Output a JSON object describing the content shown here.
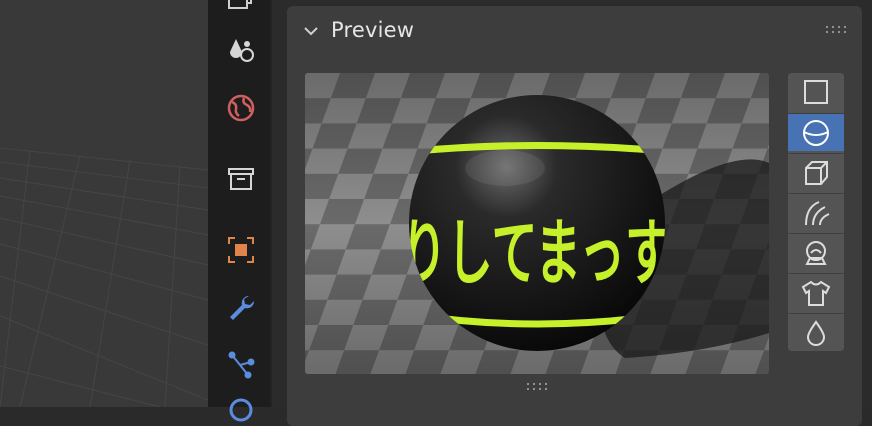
{
  "panel": {
    "title": "Preview"
  },
  "preview": {
    "text": "りしてまっす",
    "colors": {
      "sphere": "#111111",
      "accent": "#c6f02a"
    }
  },
  "tabs": [
    {
      "icon": "layers-icon"
    },
    {
      "icon": "scene-icon"
    },
    {
      "icon": "world-icon"
    },
    {
      "icon": "collection-icon"
    },
    {
      "icon": "object-icon"
    },
    {
      "icon": "modifier-wrench-icon"
    },
    {
      "icon": "particles-icon"
    }
  ],
  "preview_shapes": [
    {
      "icon": "flat-plane-icon",
      "active": false
    },
    {
      "icon": "sphere-icon",
      "active": true
    },
    {
      "icon": "cube-icon",
      "active": false
    },
    {
      "icon": "hair-icon",
      "active": false
    },
    {
      "icon": "shader-ball-icon",
      "active": false
    },
    {
      "icon": "cloth-icon",
      "active": false
    },
    {
      "icon": "fluid-icon",
      "active": false
    }
  ]
}
